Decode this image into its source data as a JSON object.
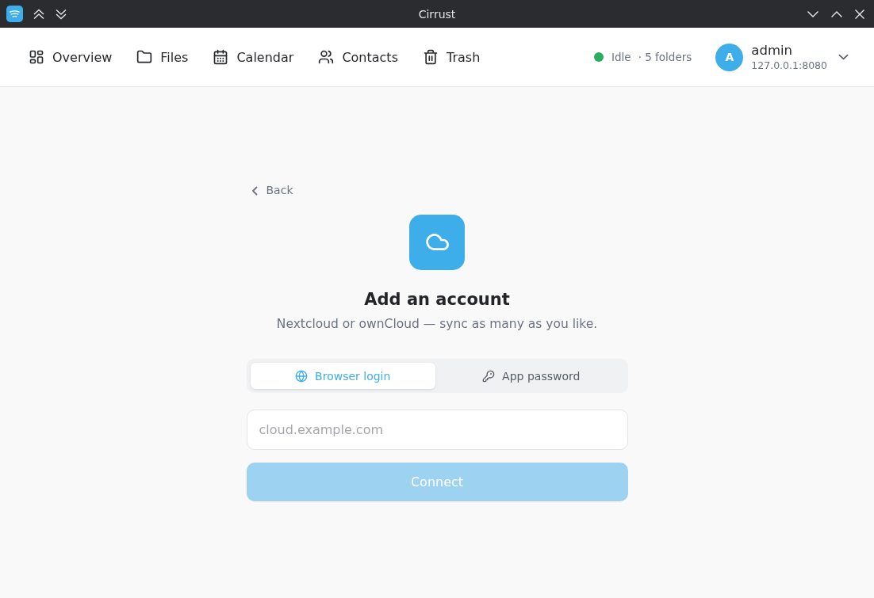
{
  "window": {
    "title": "Cirrust"
  },
  "nav": {
    "items": [
      {
        "label": "Overview",
        "kind": "overview",
        "selected": false
      },
      {
        "label": "Files",
        "kind": "files",
        "selected": false
      },
      {
        "label": "Calendar",
        "kind": "calendar",
        "selected": false
      },
      {
        "label": "Contacts",
        "kind": "contacts",
        "selected": false
      },
      {
        "label": "Trash",
        "kind": "trash",
        "selected": false
      }
    ]
  },
  "sync_status": {
    "label": "Idle",
    "detail": "· 5 folders"
  },
  "account": {
    "initial": "A",
    "name": "admin",
    "server": "127.0.0.1:8080"
  },
  "back_link": "Back",
  "heading": "Add an account",
  "subtitle": "Nextcloud or ownCloud — sync as many as you like.",
  "login_methods": [
    {
      "label": "Browser login",
      "kind": "browser",
      "selected": true
    },
    {
      "label": "App password",
      "kind": "password",
      "selected": false
    }
  ],
  "server_field": {
    "placeholder": "cloud.example.com"
  },
  "connect_button": {
    "label": "Connect",
    "disabled": true
  }
}
